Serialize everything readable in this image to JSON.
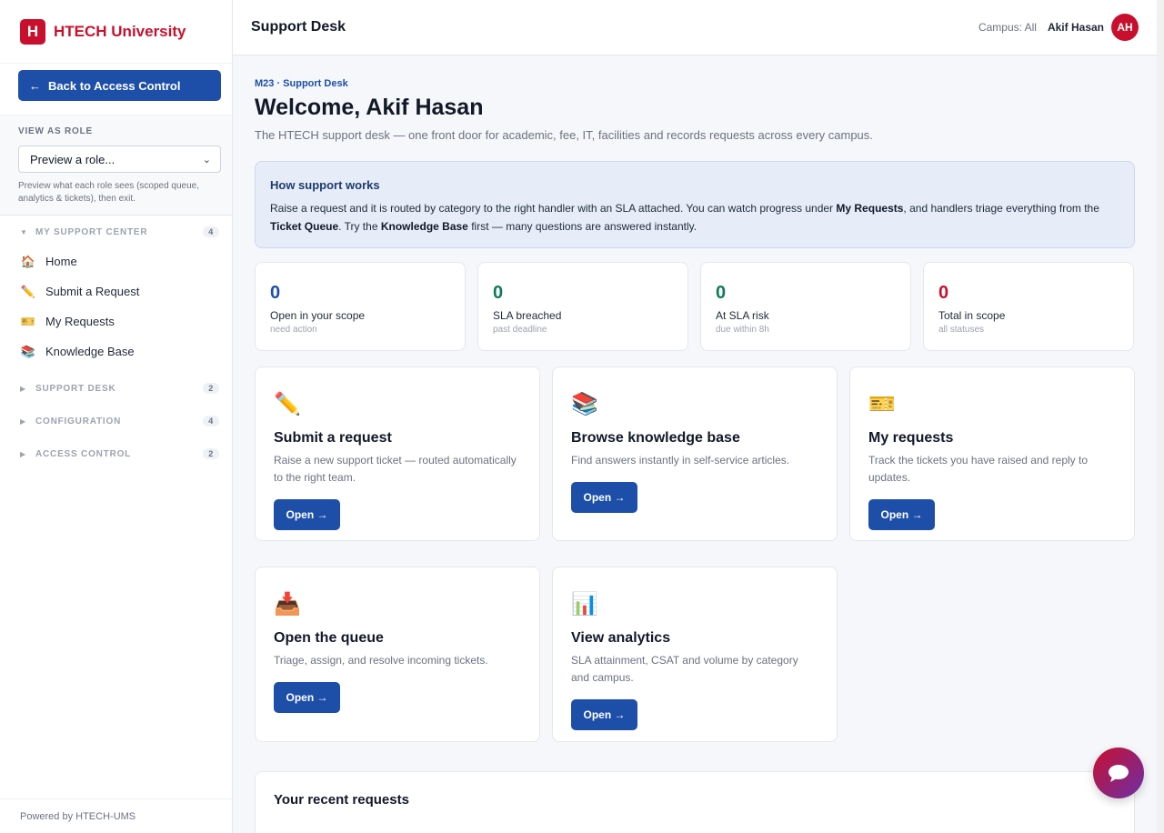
{
  "brand": {
    "logo_letter": "H",
    "name": "HTECH University"
  },
  "sidebar": {
    "back_label": "Back to Access Control",
    "role": {
      "title": "VIEW AS ROLE",
      "select_value": "Preview a role...",
      "help": "Preview what each role sees (scoped queue, analytics & tickets), then exit."
    },
    "groups": [
      {
        "label": "MY SUPPORT CENTER",
        "count": "4",
        "expanded": true
      },
      {
        "label": "SUPPORT DESK",
        "count": "2",
        "expanded": false
      },
      {
        "label": "CONFIGURATION",
        "count": "4",
        "expanded": false
      },
      {
        "label": "ACCESS CONTROL",
        "count": "2",
        "expanded": false
      }
    ],
    "items": [
      {
        "label": "Home",
        "icon": "house-icon"
      },
      {
        "label": "Submit a Request",
        "icon": "pencil-icon"
      },
      {
        "label": "My Requests",
        "icon": "ticket-icon"
      },
      {
        "label": "Knowledge Base",
        "icon": "books-icon"
      }
    ],
    "footer": "Powered by HTECH-UMS"
  },
  "header": {
    "title": "Support Desk",
    "campus": "Campus: All",
    "user": "Akif Hasan",
    "avatar_initials": "AH"
  },
  "main": {
    "eyebrow": "M23 · Support Desk",
    "welcome": "Welcome, Akif Hasan",
    "subtitle": "The HTECH support desk — one front door for academic, fee, IT, facilities and records requests across every campus.",
    "info": {
      "title": "How support works",
      "text_1": "Raise a request and it is routed by category to the right handler with an SLA attached. You can watch progress under ",
      "bold_1": "My Requests",
      "text_2": ", and handlers triage everything from the ",
      "bold_2": "Ticket Queue",
      "text_3": ". Try the ",
      "bold_3": "Knowledge Base",
      "text_4": " first — many questions are answered instantly."
    },
    "stats": [
      {
        "value": "0",
        "label": "Open in your scope",
        "sub": "need action",
        "color": "#1d4fa8"
      },
      {
        "value": "0",
        "label": "SLA breached",
        "sub": "past deadline",
        "color": "#0f7a5a"
      },
      {
        "value": "0",
        "label": "At SLA risk",
        "sub": "due within 8h",
        "color": "#0f7a5a"
      },
      {
        "value": "0",
        "label": "Total in scope",
        "sub": "all statuses",
        "color": "#c8102e"
      }
    ],
    "cards": [
      {
        "icon": "pencil-icon",
        "title": "Submit a request",
        "desc": "Raise a new support ticket — routed automatically to the right team.",
        "button": "Open →"
      },
      {
        "icon": "books-icon",
        "title": "Browse knowledge base",
        "desc": "Find answers instantly in self-service articles.",
        "button": "Open →"
      },
      {
        "icon": "ticket-icon",
        "title": "My requests",
        "desc": "Track the tickets you have raised and reply to updates.",
        "button": "Open →"
      },
      {
        "icon": "inbox-icon",
        "title": "Open the queue",
        "desc": "Triage, assign, and resolve incoming tickets.",
        "button": "Open →"
      },
      {
        "icon": "bar-chart-icon",
        "title": "View analytics",
        "desc": "SLA attainment, CSAT and volume by category and campus.",
        "button": "Open →"
      }
    ],
    "recent_title": "Your recent requests"
  },
  "colors": {
    "brand_red": "#c8102e",
    "primary_blue": "#1d4fa8"
  }
}
